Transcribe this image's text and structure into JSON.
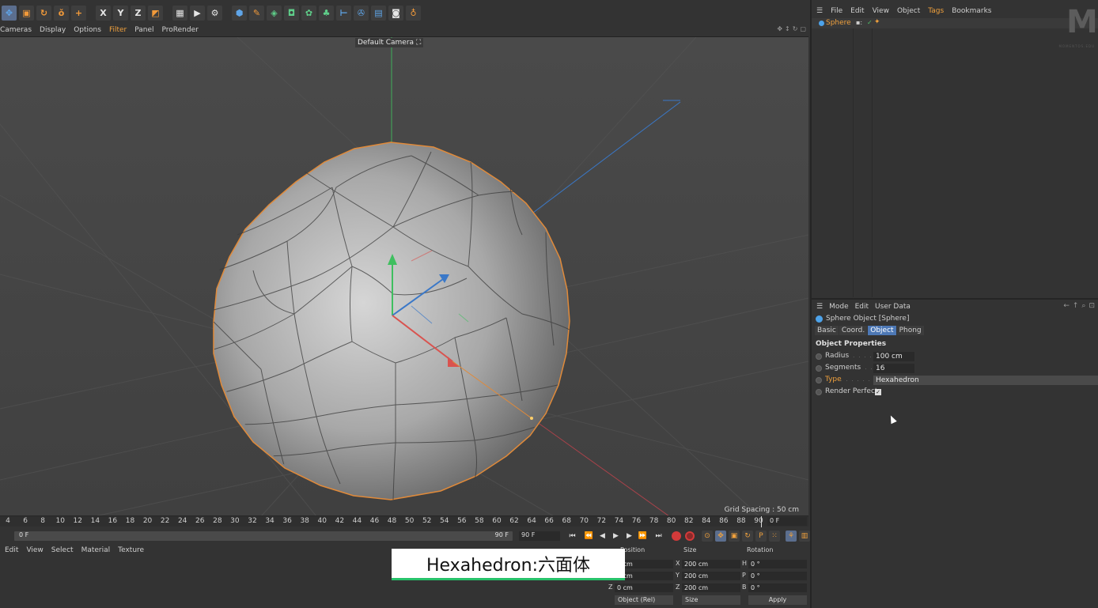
{
  "toolbar": {
    "buttons": [
      {
        "name": "move-tool-icon",
        "glyph": "✥"
      },
      {
        "name": "scale-tool-icon",
        "glyph": "▣"
      },
      {
        "name": "rotate-tool-icon",
        "glyph": "↻"
      },
      {
        "name": "live-selection-icon",
        "glyph": "ǒ"
      },
      {
        "name": "add-object-icon",
        "glyph": "+"
      },
      {
        "name": "x-axis-lock-icon",
        "glyph": "X"
      },
      {
        "name": "y-axis-lock-icon",
        "glyph": "Y"
      },
      {
        "name": "z-axis-lock-icon",
        "glyph": "Z"
      },
      {
        "name": "coordinate-system-icon",
        "glyph": "◩"
      },
      {
        "name": "render-region-icon",
        "glyph": "▦"
      },
      {
        "name": "render-view-icon",
        "glyph": "▶"
      },
      {
        "name": "render-settings-icon",
        "glyph": "⚙"
      },
      {
        "name": "cube-primitive-icon",
        "glyph": "⬢"
      },
      {
        "name": "pen-spline-icon",
        "glyph": "✎"
      },
      {
        "name": "subdivision-icon",
        "glyph": "◈"
      },
      {
        "name": "extrude-generator-icon",
        "glyph": "◘"
      },
      {
        "name": "mograph-cloner-icon",
        "glyph": "✿"
      },
      {
        "name": "deformer-icon",
        "glyph": "♣"
      },
      {
        "name": "scene-floor-icon",
        "glyph": "⊢"
      },
      {
        "name": "camera-tag-icon",
        "glyph": "✇"
      },
      {
        "name": "environment-icon",
        "glyph": "▤"
      },
      {
        "name": "camera-icon",
        "glyph": "◙"
      },
      {
        "name": "light-icon",
        "glyph": "♁"
      }
    ]
  },
  "viewport": {
    "menu": [
      "Cameras",
      "Display",
      "Options",
      "Filter",
      "Panel",
      "ProRender"
    ],
    "highlighted_menu": "Filter",
    "camera_label": "Default Camera",
    "grid_spacing": "Grid Spacing : 50 cm"
  },
  "timeline": {
    "ticks": [
      "4",
      "6",
      "8",
      "10",
      "12",
      "14",
      "16",
      "18",
      "20",
      "22",
      "24",
      "26",
      "28",
      "30",
      "32",
      "34",
      "36",
      "38",
      "40",
      "42",
      "44",
      "46",
      "48",
      "50",
      "52",
      "54",
      "56",
      "58",
      "60",
      "62",
      "64",
      "66",
      "68",
      "70",
      "72",
      "74",
      "76",
      "78",
      "80",
      "82",
      "84",
      "86",
      "88",
      "90"
    ],
    "current_frame": "0 F",
    "range_start": "0 F",
    "range_end": "90 F",
    "end_frame": "90 F"
  },
  "material_manager": {
    "menu": [
      "Edit",
      "View",
      "Select",
      "Material",
      "Texture"
    ]
  },
  "coordinates": {
    "headers": {
      "position": "Position",
      "size": "Size",
      "rotation": "Rotation"
    },
    "rows": [
      {
        "axis": "X",
        "position": "0 cm",
        "size_axis": "X",
        "size": "200 cm",
        "rot_axis": "H",
        "rotation": "0 °"
      },
      {
        "axis": "Y",
        "position": "0 cm",
        "size_axis": "Y",
        "size": "200 cm",
        "rot_axis": "P",
        "rotation": "0 °"
      },
      {
        "axis": "Z",
        "position": "0 cm",
        "size_axis": "Z",
        "size": "200 cm",
        "rot_axis": "B",
        "rotation": "0 °"
      }
    ],
    "position_mode": "Object (Rel)",
    "size_mode": "Size",
    "apply_label": "Apply"
  },
  "caption": {
    "text": "Hexahedron:六面体"
  },
  "object_manager": {
    "menu": [
      "File",
      "Edit",
      "View",
      "Object",
      "Tags",
      "Bookmarks"
    ],
    "highlighted_menu": "Tags",
    "objects": [
      {
        "name": "Sphere"
      }
    ],
    "logo": "M",
    "logo_sub": "MOMENTOS.EDU"
  },
  "attribute_manager": {
    "menu": [
      "Mode",
      "Edit",
      "User Data"
    ],
    "title": "Sphere Object [Sphere]",
    "tabs": [
      "Basic",
      "Coord.",
      "Object",
      "Phong"
    ],
    "active_tab": "Object",
    "section_title": "Object Properties",
    "properties": {
      "radius": {
        "label": "Radius",
        "value": "100 cm"
      },
      "segments": {
        "label": "Segments",
        "value": "16"
      },
      "type": {
        "label": "Type",
        "value": "Hexahedron"
      },
      "render_perfect": {
        "label": "Render Perfect",
        "checked": true
      }
    }
  },
  "colors": {
    "accent_orange": "#f0a13d",
    "selection_blue": "#4d78b5",
    "caption_green": "#27c26a"
  }
}
